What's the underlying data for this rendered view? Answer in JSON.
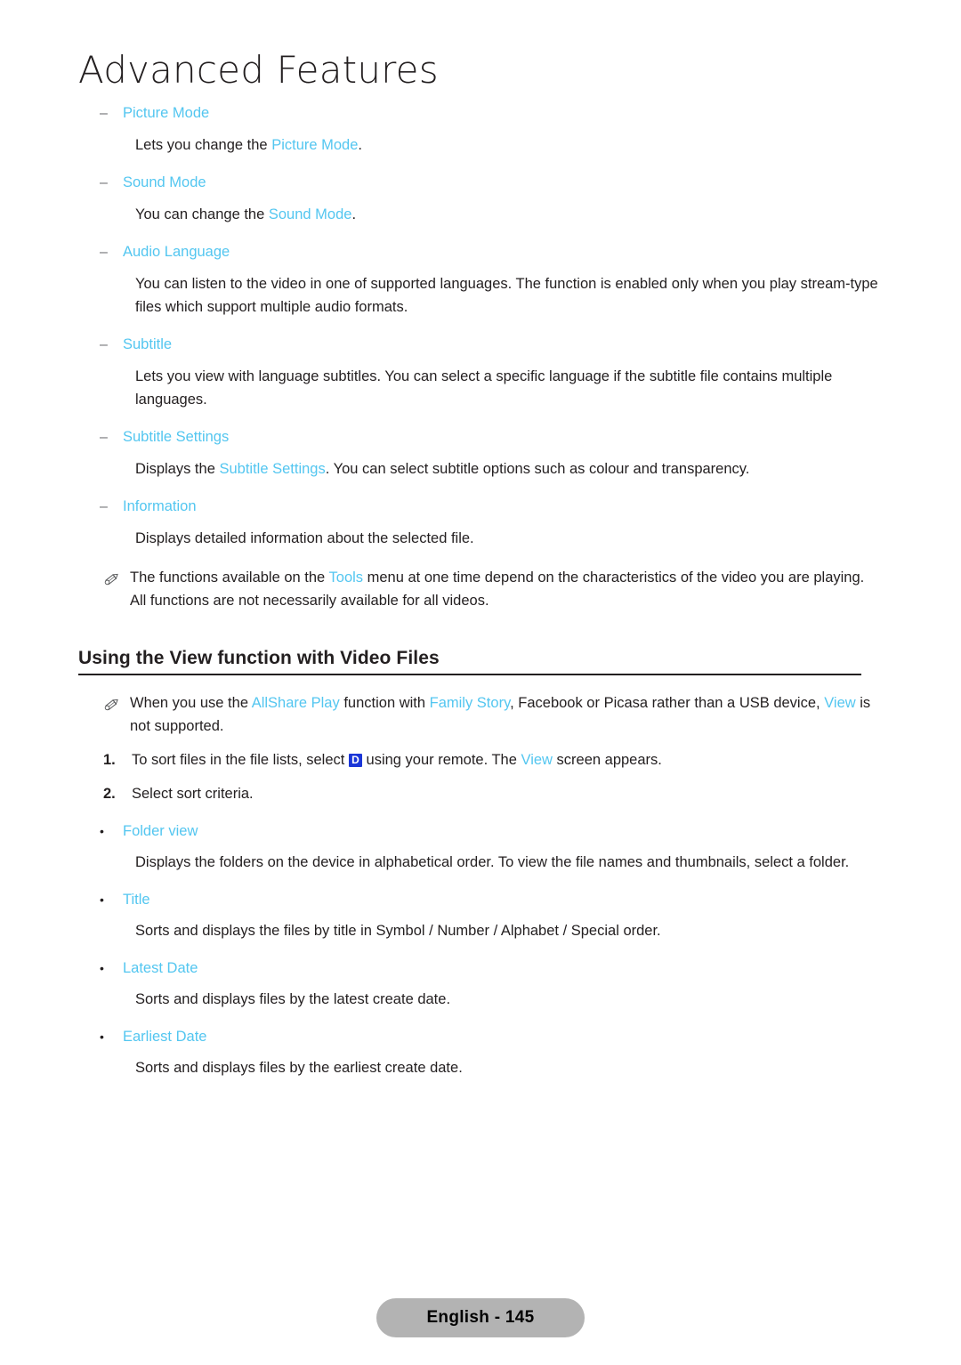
{
  "chapter": {
    "title": "Advanced Features"
  },
  "options": [
    {
      "marker": "–",
      "label": "Picture Mode",
      "body_pre": "Lets you change the ",
      "body_link": "Picture Mode",
      "body_post": "."
    },
    {
      "marker": "–",
      "label": "Sound Mode",
      "body_pre": "You can change the ",
      "body_link": "Sound Mode",
      "body_post": "."
    },
    {
      "marker": "–",
      "label": "Audio Language",
      "body_pre": "You can listen to the video in one of supported languages. The function is enabled only when you play stream-type files which support multiple audio formats.",
      "body_link": "",
      "body_post": ""
    },
    {
      "marker": "–",
      "label": "Subtitle",
      "body_pre": "Lets you view with language subtitles. You can select a specific language if the subtitle file contains multiple languages.",
      "body_link": "",
      "body_post": ""
    },
    {
      "marker": "–",
      "label": "Subtitle Settings",
      "body_pre": "Displays the ",
      "body_link": "Subtitle Settings",
      "body_post": ". You can select subtitle options such as colour and transparency."
    },
    {
      "marker": "–",
      "label": "Information",
      "body_pre": "Displays detailed information about the selected file.",
      "body_link": "",
      "body_post": ""
    }
  ],
  "note_tools": {
    "icon": "pencil-icon",
    "pre": "The functions available on the ",
    "link": "Tools",
    "post": " menu at one time depend on the characteristics of the video you are playing. All functions are not necessarily available for all videos."
  },
  "section": {
    "heading": "Using the View function with Video Files"
  },
  "note_allshare": {
    "icon": "pencil-icon",
    "pre": "When you use the ",
    "link1": "AllShare Play",
    "mid1": " function with ",
    "link2": "Family Story",
    "mid2": ", Facebook or Picasa rather than a USB device, ",
    "link3": "View",
    "post": " is not supported."
  },
  "steps": [
    {
      "num": "1.",
      "pre": "To sort files in the file lists, select ",
      "key": "D",
      "mid": " using your remote. The ",
      "link": "View",
      "post": " screen appears."
    },
    {
      "num": "2.",
      "pre": "Select sort criteria.",
      "key": "",
      "mid": "",
      "link": "",
      "post": ""
    }
  ],
  "sort_criteria": [
    {
      "marker": "•",
      "label": "Folder view",
      "body": "Displays the folders on the device in alphabetical order. To view the file names and thumbnails, select a folder."
    },
    {
      "marker": "•",
      "label": "Title",
      "body": "Sorts and displays the files by title in Symbol / Number / Alphabet / Special order."
    },
    {
      "marker": "•",
      "label": "Latest Date",
      "body": "Sorts and displays files by the latest create date."
    },
    {
      "marker": "•",
      "label": "Earliest Date",
      "body": "Sorts and displays files by the earliest create date."
    }
  ],
  "footer": {
    "label": "English - 145"
  },
  "colors": {
    "link": "#53c6f0",
    "text": "#231f20",
    "key_badge_bg": "#1b36d8",
    "footer_badge_bg": "#b3b3b3"
  }
}
